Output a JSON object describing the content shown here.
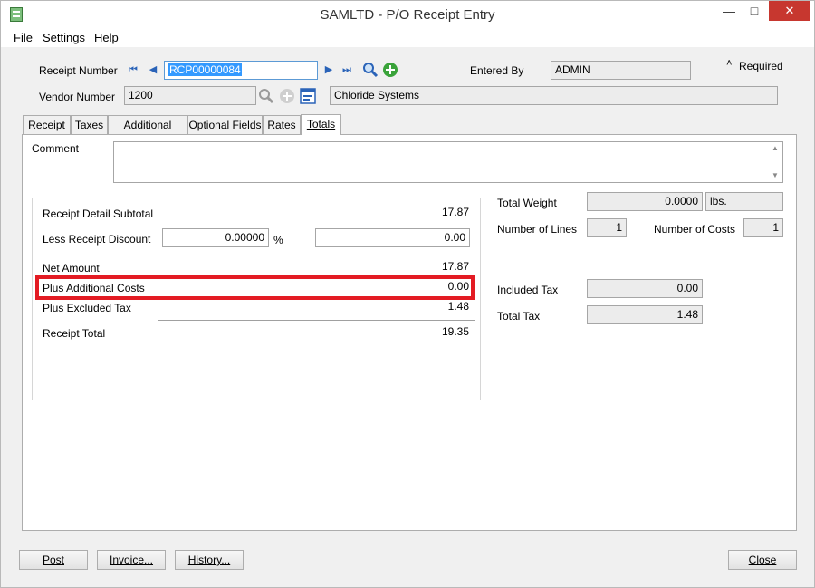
{
  "window": {
    "title": "SAMLTD - P/O Receipt Entry",
    "controls": {
      "minimize": "—",
      "maximize": "□",
      "close": "✕"
    }
  },
  "menu": [
    "File",
    "Settings",
    "Help"
  ],
  "header": {
    "receipt_number_label": "Receipt Number",
    "receipt_number": "RCP00000084",
    "entered_by_label": "Entered By",
    "entered_by": "ADMIN",
    "required_mark": "˄",
    "required_label": "Required",
    "vendor_number_label": "Vendor Number",
    "vendor_number": "1200",
    "vendor_name": "Chloride Systems"
  },
  "tabs": [
    "Receipt",
    "Taxes",
    "Additional Costs",
    "Optional Fields",
    "Rates",
    "Totals"
  ],
  "active_tab": "Totals",
  "totals": {
    "comment_label": "Comment",
    "comment": "",
    "receipt_detail_subtotal_label": "Receipt Detail Subtotal",
    "receipt_detail_subtotal": "17.87",
    "less_receipt_discount_label": "Less Receipt Discount",
    "discount_percent": "0.00000",
    "percent_sign": "%",
    "discount_amount": "0.00",
    "net_amount_label": "Net Amount",
    "net_amount": "17.87",
    "plus_additional_costs_label": "Plus Additional Costs",
    "plus_additional_costs": "0.00",
    "plus_excluded_tax_label": "Plus Excluded Tax",
    "plus_excluded_tax": "1.48",
    "receipt_total_label": "Receipt Total",
    "receipt_total": "19.35",
    "total_weight_label": "Total Weight",
    "total_weight": "0.0000",
    "weight_unit": "lbs.",
    "number_of_lines_label": "Number of Lines",
    "number_of_lines": "1",
    "number_of_costs_label": "Number of Costs",
    "number_of_costs": "1",
    "included_tax_label": "Included Tax",
    "included_tax": "0.00",
    "total_tax_label": "Total Tax",
    "total_tax": "1.48"
  },
  "buttons": {
    "post": "Post",
    "invoice": "Invoice...",
    "history": "History...",
    "close": "Close"
  },
  "colors": {
    "highlight": "#e31b23",
    "selection": "#3399ff"
  }
}
